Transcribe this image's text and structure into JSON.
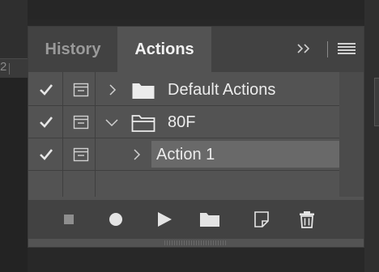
{
  "panel": {
    "tabs": [
      {
        "label": "History",
        "active": false
      },
      {
        "label": "Actions",
        "active": true
      }
    ],
    "header_icons": [
      "expand-panels-icon",
      "panel-menu-icon"
    ]
  },
  "actions_list": {
    "rows": [
      {
        "label": "Default Actions",
        "type": "set",
        "enabled": true,
        "expanded": false,
        "selected": false
      },
      {
        "label": "80F",
        "type": "set",
        "enabled": true,
        "expanded": true,
        "selected": false
      },
      {
        "label": "Action 1",
        "type": "action",
        "enabled": true,
        "expanded": false,
        "selected": true
      }
    ]
  },
  "toolbar": {
    "buttons": [
      {
        "icon": "stop-icon"
      },
      {
        "icon": "record-icon"
      },
      {
        "icon": "play-icon"
      },
      {
        "icon": "new-set-folder-icon"
      },
      {
        "icon": "new-action-icon"
      },
      {
        "icon": "trash-icon"
      }
    ]
  },
  "background": {
    "ruler_number": "2"
  },
  "colors": {
    "panel_bg": "#535353",
    "header_bg": "#424242",
    "selected_row": "#696969",
    "text": "#ececec",
    "icon": "#d0d0d0"
  }
}
